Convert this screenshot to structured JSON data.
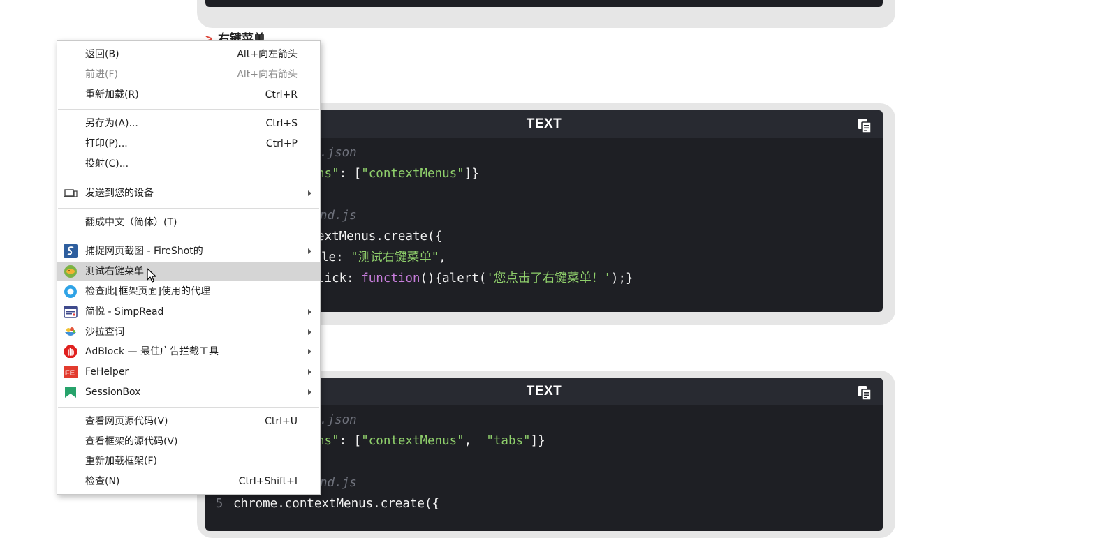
{
  "section": {
    "heading": "右键菜单"
  },
  "code_blocks": [
    {
      "title": "TEXT",
      "lines": [
        {
          "segments": [
            {
              "t": ".json",
              "c": "c-comment"
            }
          ]
        },
        {
          "segments": [
            {
              "t": "ns\"",
              "c": "c-str"
            },
            {
              "t": ": [",
              "c": "c-plain"
            },
            {
              "t": "\"contextMenus\"",
              "c": "c-str"
            },
            {
              "t": "]}",
              "c": "c-plain"
            }
          ]
        },
        {
          "segments": []
        },
        {
          "segments": [
            {
              "t": "nd.js",
              "c": "c-comment"
            }
          ]
        },
        {
          "segments": [
            {
              "t": "extMenus.create({",
              "c": "c-plain"
            }
          ]
        },
        {
          "segments": [
            {
              "t": "le: ",
              "c": "c-plain"
            },
            {
              "t": "\"测试右键菜单\"",
              "c": "c-str"
            },
            {
              "t": ",",
              "c": "c-plain"
            }
          ]
        },
        {
          "segments": [
            {
              "t": "lick: ",
              "c": "c-plain"
            },
            {
              "t": "function",
              "c": "c-kw"
            },
            {
              "t": "(){alert(",
              "c": "c-plain"
            },
            {
              "t": "'您点击了右键菜单！'",
              "c": "c-str"
            },
            {
              "t": ");}",
              "c": "c-plain"
            }
          ]
        }
      ]
    },
    {
      "title": "TEXT",
      "lines": [
        {
          "segments": [
            {
              "t": ".json",
              "c": "c-comment"
            }
          ]
        },
        {
          "segments": [
            {
              "t": "ns\"",
              "c": "c-str"
            },
            {
              "t": ": [",
              "c": "c-plain"
            },
            {
              "t": "\"contextMenus\"",
              "c": "c-str"
            },
            {
              "t": ",  ",
              "c": "c-plain"
            },
            {
              "t": "\"tabs\"",
              "c": "c-str"
            },
            {
              "t": "]}",
              "c": "c-plain"
            }
          ]
        },
        {
          "segments": []
        },
        {
          "segments": [
            {
              "t": "nd.js",
              "c": "c-comment"
            }
          ]
        },
        {
          "ln": "5",
          "segments": [
            {
              "t": "chrome.contextMenus.create({",
              "c": "c-plain"
            }
          ]
        }
      ]
    }
  ],
  "context_menu": {
    "items": [
      {
        "label": "返回(B)",
        "shortcut": "Alt+向左箭头"
      },
      {
        "label": "前进(F)",
        "shortcut": "Alt+向右箭头",
        "disabled": true
      },
      {
        "label": "重新加载(R)",
        "shortcut": "Ctrl+R"
      },
      {
        "sep": true
      },
      {
        "label": "另存为(A)...",
        "shortcut": "Ctrl+S"
      },
      {
        "label": "打印(P)...",
        "shortcut": "Ctrl+P"
      },
      {
        "label": "投射(C)..."
      },
      {
        "sep": true
      },
      {
        "label": "发送到您的设备",
        "icon": "device-icon",
        "submenu": true
      },
      {
        "sep": true
      },
      {
        "label": "翻成中文（简体）(T)"
      },
      {
        "sep": true
      },
      {
        "label": "捕捉网页截图 - FireShot的",
        "icon": "fireshot-icon",
        "submenu": true
      },
      {
        "label": "测试右键菜单",
        "icon": "test-extension-icon",
        "highlight": true
      },
      {
        "label": "检查此[框架页面]使用的代理",
        "icon": "proxy-icon"
      },
      {
        "label": "简悦 - SimpRead",
        "icon": "simpread-icon",
        "submenu": true
      },
      {
        "label": "沙拉查词",
        "icon": "saladict-icon",
        "submenu": true
      },
      {
        "label": "AdBlock — 最佳广告拦截工具",
        "icon": "adblock-icon",
        "submenu": true
      },
      {
        "label": "FeHelper",
        "icon": "fehelper-icon",
        "submenu": true
      },
      {
        "label": "SessionBox",
        "icon": "sessionbox-icon",
        "submenu": true
      },
      {
        "sep": true
      },
      {
        "label": "查看网页源代码(V)",
        "shortcut": "Ctrl+U"
      },
      {
        "label": "查看框架的源代码(V)"
      },
      {
        "label": "重新加载框架(F)"
      },
      {
        "label": "检查(N)",
        "shortcut": "Ctrl+Shift+I"
      }
    ]
  }
}
